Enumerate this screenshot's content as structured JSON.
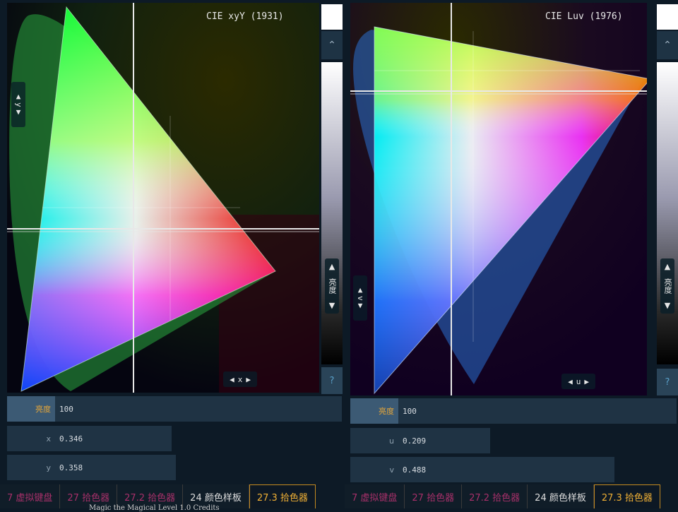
{
  "left": {
    "title": "CIE xyY (1931)",
    "y_axis": {
      "label": "y",
      "up": "▲",
      "down": "▼"
    },
    "x_axis": {
      "label": "x",
      "left": "◀",
      "right": "▶"
    },
    "up_glyph": "⌃",
    "slider": {
      "label": "亮度",
      "up": "▲",
      "down": "▼"
    },
    "help": "?",
    "swatch_color": "#ffffff",
    "fields": [
      {
        "label": "亮度",
        "value": "100",
        "active": true
      },
      {
        "label": "x",
        "value": "0.346",
        "active": false
      },
      {
        "label": "y",
        "value": "0.358",
        "active": false
      }
    ],
    "status": "Magic the Magical Level 1.0 Credits"
  },
  "right": {
    "title": "CIE Luv (1976)",
    "y_axis": {
      "label": "v",
      "up": "▲",
      "down": "▼"
    },
    "x_axis": {
      "label": "u",
      "left": "◀",
      "right": "▶"
    },
    "up_glyph": "⌃",
    "slider": {
      "label": "亮度",
      "up": "▲",
      "down": "▼"
    },
    "help": "?",
    "swatch_color": "#ffffff",
    "fields": [
      {
        "label": "亮度",
        "value": "100",
        "active": true
      },
      {
        "label": "u",
        "value": "0.209",
        "active": false
      },
      {
        "label": "v",
        "value": "0.488",
        "active": false
      }
    ]
  },
  "tabs": [
    {
      "label": "7 虚拟键盘",
      "state": "inactive"
    },
    {
      "label": "27 拾色器",
      "state": "inactive"
    },
    {
      "label": "27.2 拾色器",
      "state": "inactive"
    },
    {
      "label": "24 颜色样板",
      "state": "plain"
    },
    {
      "label": "27.3 拾色器",
      "state": "active"
    }
  ]
}
